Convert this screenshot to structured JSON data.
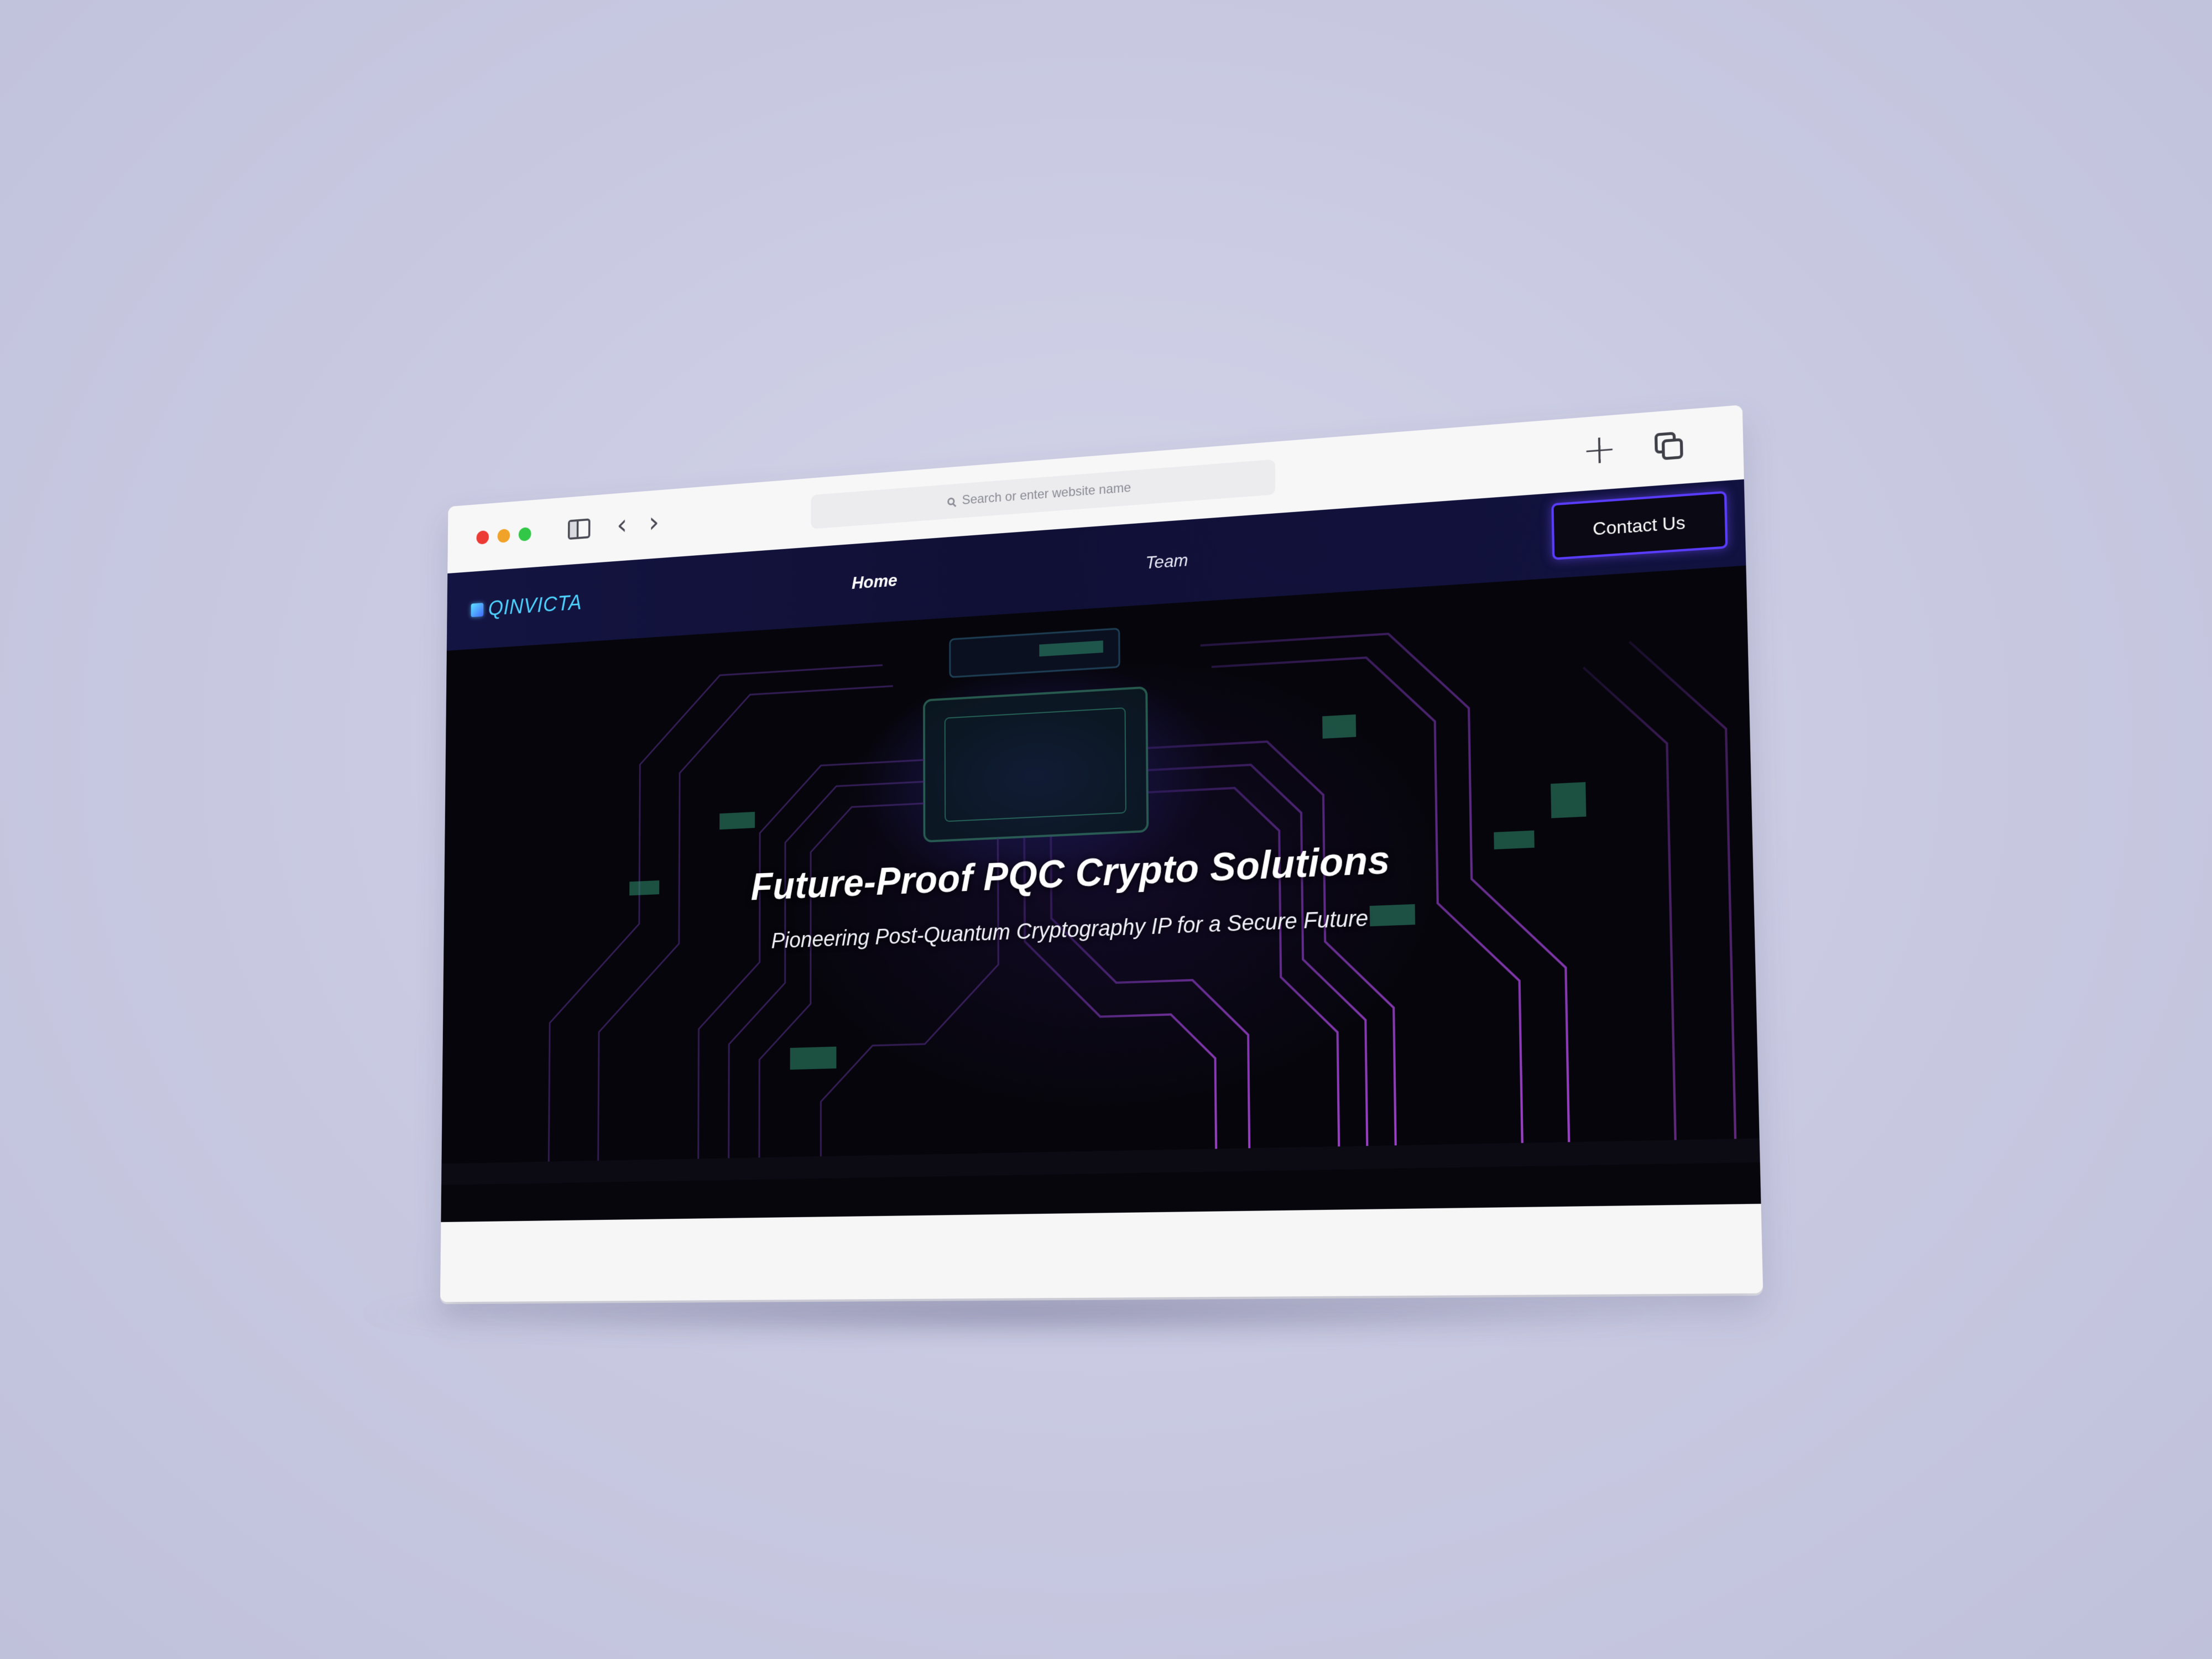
{
  "browser": {
    "address_placeholder": "Search or enter website name",
    "new_tab_symbol": "+",
    "back_symbol": "‹",
    "forward_symbol": "›"
  },
  "site": {
    "logo": "QINVICTA",
    "nav": {
      "home": "Home",
      "team": "Team",
      "contact": "Contact Us"
    },
    "hero": {
      "title": "Future-Proof PQC Crypto Solutions",
      "subtitle": "Pioneering Post-Quantum Cryptography IP for a Secure Future"
    }
  },
  "colors": {
    "background": "#c8c9e1",
    "header": "#121240",
    "logo": "#4fd3ff",
    "contact_border": "#5a3cff",
    "circuit_purple": "#8a3cc8",
    "circuit_green": "#3fae8a"
  },
  "icons": [
    "close-dot",
    "minimize-dot",
    "zoom-dot",
    "sidebar-icon",
    "back-icon",
    "forward-icon",
    "search-icon",
    "plus-icon",
    "tabs-icon"
  ]
}
